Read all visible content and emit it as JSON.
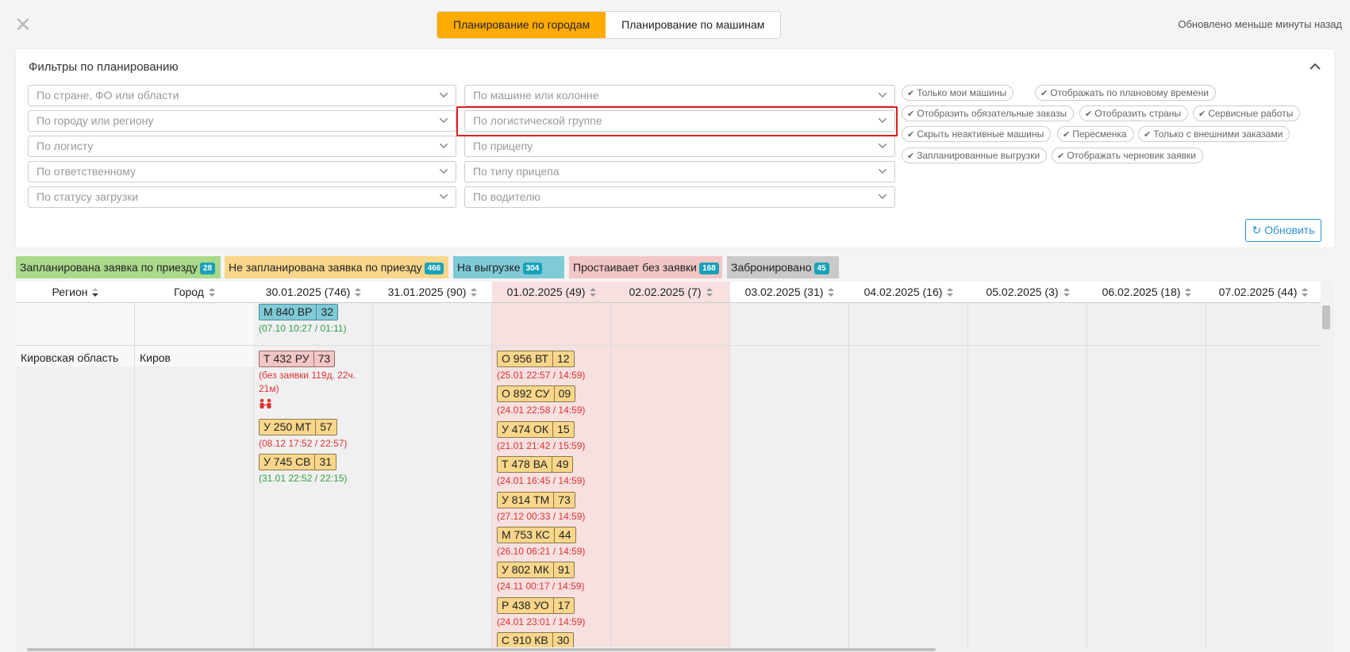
{
  "header": {
    "modes": [
      "Планирование по городам",
      "Планирование по машинам"
    ],
    "active_mode": 0,
    "updated": "Обновлено меньше минуты назад"
  },
  "filters": {
    "title": "Фильтры по планированию",
    "left": [
      "По стране, ФО или области",
      "По городу или региону",
      "По логисту",
      "По ответственному",
      "По статусу загрузки"
    ],
    "middle": [
      "По машине или колонне",
      "По логистической группе",
      "По прицепу",
      "По типу прицепа",
      "По водителю"
    ],
    "chips": [
      [
        "Только мои машины",
        "Отображать по плановому времени"
      ],
      [
        "Отобразить обязательные заказы",
        "Отобразить страны",
        "Сервисные работы"
      ],
      [
        "Скрыть неактивные машины",
        "Пересменка",
        "Только с внешними заказами"
      ],
      [
        "Запланированные выгрузки",
        "Отображать черновик заявки"
      ]
    ],
    "refresh": "Обновить"
  },
  "legend": [
    {
      "label": "Запланирована заявка по приезду",
      "count": "28",
      "color": "#a9d98b"
    },
    {
      "label": "Не запланирована заявка по приезду",
      "count": "466",
      "color": "#f9d68a"
    },
    {
      "label": "На выгрузке",
      "count": "304",
      "color": "#7ecad6"
    },
    {
      "label": "Простаивает без заявки",
      "count": "168",
      "color": "#f3c6c6"
    },
    {
      "label": "Забронировано",
      "count": "45",
      "color": "#c9c9c9"
    }
  ],
  "table": {
    "columns": [
      "Регион",
      "Город",
      "30.01.2025 (746)",
      "31.01.2025 (90)",
      "01.02.2025 (49)",
      "02.02.2025 (7)",
      "03.02.2025 (31)",
      "04.02.2025 (16)",
      "05.02.2025 (3)",
      "06.02.2025 (18)",
      "07.02.2025 (44)"
    ],
    "top_vehicle": {
      "num": "М 840 ВР",
      "cnt": "32",
      "info": "(07.10 10:27 / 01:11)"
    },
    "row": {
      "region": "Кировская область",
      "city": "Киров",
      "col30": [
        {
          "num": "Т 432 РУ",
          "cnt": "73",
          "info1": "(без заявки 119д. 22ч.",
          "info2": "21м)",
          "style": "p",
          "tone": "red"
        },
        {
          "num": "У 250 МТ",
          "cnt": "57",
          "info": "(08.12 17:52 / 22:57)",
          "style": "y",
          "tone": "red"
        },
        {
          "num": "У 745 СВ",
          "cnt": "31",
          "info": "(31.01 22:52 / 22:15)",
          "style": "y",
          "tone": "green"
        }
      ],
      "col01": [
        {
          "num": "О 956 ВТ",
          "cnt": "12",
          "info": "(25.01 22:57 / 14:59)"
        },
        {
          "num": "О 892 СУ",
          "cnt": "09",
          "info": "(24.01 22:58 / 14:59)"
        },
        {
          "num": "У 474 ОК",
          "cnt": "15",
          "info": "(21.01 21:42 / 15:59)"
        },
        {
          "num": "Т 478 ВА",
          "cnt": "49",
          "info": "(24.01 16:45 / 14:59)"
        },
        {
          "num": "У 814 ТМ",
          "cnt": "73",
          "info": "(27.12 00:33 / 14:59)"
        },
        {
          "num": "М 753 КС",
          "cnt": "44",
          "info": "(26.10 06:21 / 14:59)"
        },
        {
          "num": "У 802 МК",
          "cnt": "91",
          "info": "(24.11 00:17 / 14:59)"
        },
        {
          "num": "Р 438 УО",
          "cnt": "17",
          "info": "(24.01 23:01 / 14:59)"
        },
        {
          "num": "С 910 КВ",
          "cnt": "30",
          "info": ""
        }
      ]
    }
  },
  "icons": {
    "close": "close-icon",
    "collapse": "chevron-up-icon",
    "driver_swap": "driver-swap-icon",
    "refresh": "refresh-icon"
  }
}
